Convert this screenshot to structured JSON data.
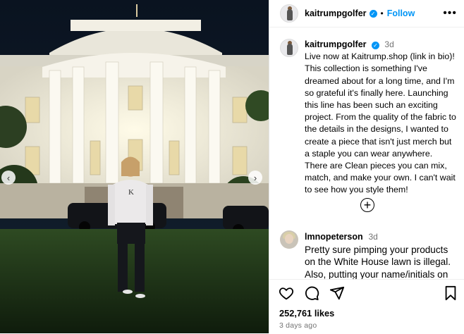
{
  "post": {
    "author": "kaitrumpgolfer",
    "follow_label": "Follow",
    "caption_author": "kaitrumpgolfer",
    "caption_time": "3d",
    "caption": "Live now at Kaitrump.shop (link in bio)! This collection is something I've dreamed about for a long time, and I'm so grateful it's finally here. Launching this line has been such an exciting project. From the quality of the fabric to the details in the designs, I wanted to create a piece that isn't just merch but a staple you can wear anywhere. There are Clean pieces you can mix, match, and make your own. I can't wait to see how you style them!",
    "likes": "252,761 likes",
    "posted": "3 days ago"
  },
  "comment": {
    "author": "lmnopeterson",
    "time": "3d",
    "text": "Pretty sure pimping your products on the White House lawn is illegal. Also, putting your name/initials on"
  },
  "icons": {
    "verified": "verified-badge-icon",
    "more": "more-options-icon",
    "add_comment": "plus-circle-icon",
    "like": "heart-icon",
    "comment": "comment-bubble-icon",
    "share": "paper-plane-icon",
    "save": "bookmark-icon",
    "prev": "chevron-left-icon",
    "next": "chevron-right-icon"
  },
  "colors": {
    "link_blue": "#0095f6",
    "muted_text": "#737373",
    "sky": "#0b1420"
  }
}
